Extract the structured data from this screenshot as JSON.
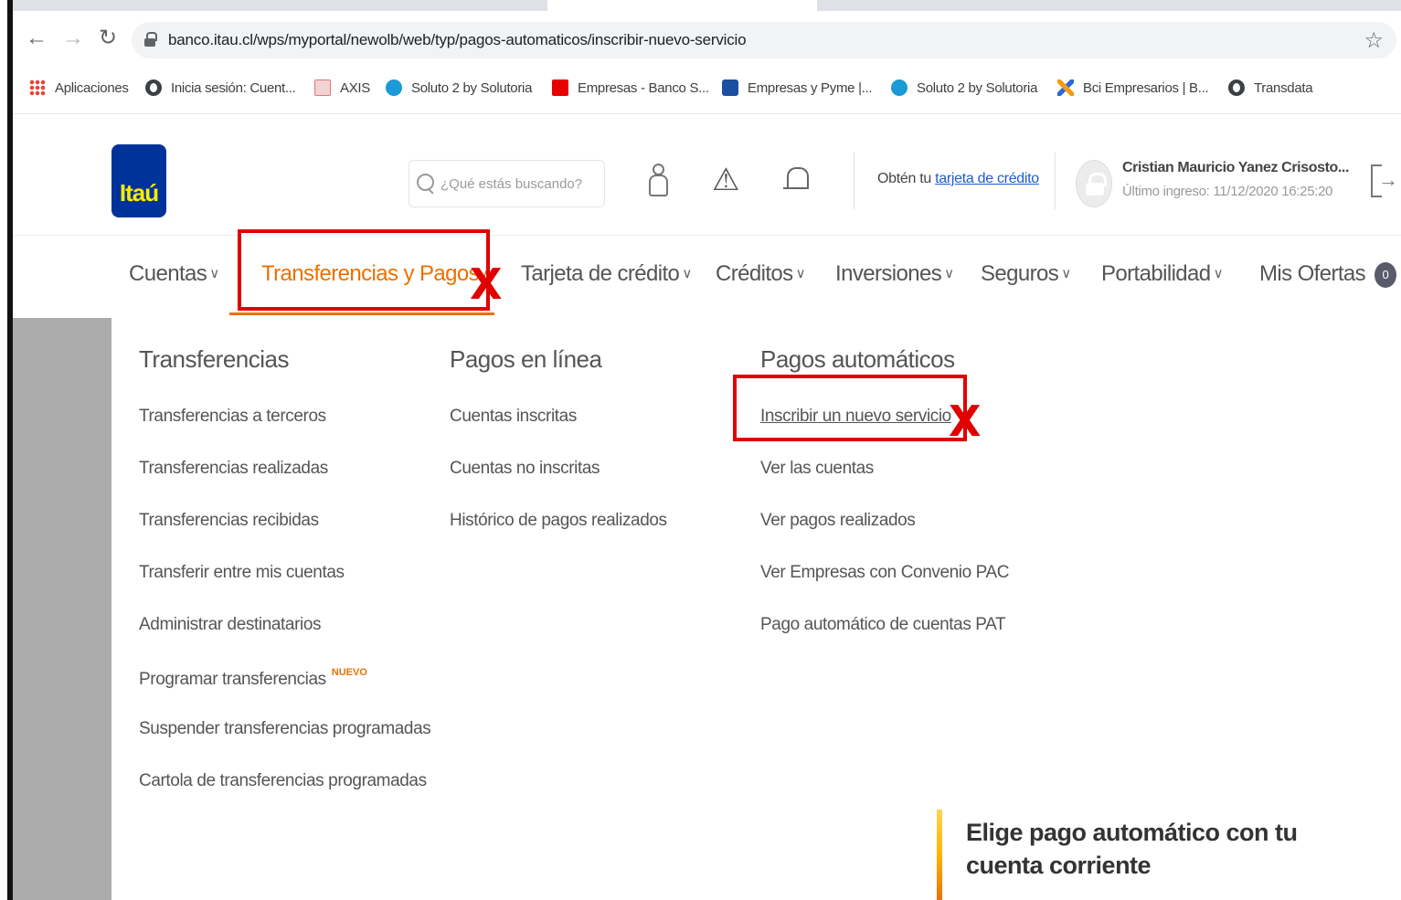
{
  "browser": {
    "url": "banco.itau.cl/wps/myportal/newolb/web/typ/pagos-automaticos/inscribir-nuevo-servicio",
    "bookmarks": [
      {
        "label": "Aplicaciones",
        "icon": "apps-grid-icon"
      },
      {
        "label": "Inicia sesión: Cuent...",
        "icon": "globe-icon"
      },
      {
        "label": "AXIS",
        "icon": "axis-icon"
      },
      {
        "label": "Soluto 2 by Solutoria",
        "icon": "soluto-icon"
      },
      {
        "label": "Empresas - Banco S...",
        "icon": "santander-icon"
      },
      {
        "label": "Empresas y Pyme |...",
        "icon": "bci-icon"
      },
      {
        "label": "Soluto 2 by Solutoria",
        "icon": "soluto-icon"
      },
      {
        "label": "Bci Empresarios | B...",
        "icon": "bci-empresarios-icon"
      },
      {
        "label": "Transdata",
        "icon": "globe-icon"
      }
    ]
  },
  "header": {
    "logo_text": "Itaú",
    "search_placeholder": "¿Qué estás buscando?",
    "promo_prefix": "Obtén tu ",
    "promo_link": "tarjeta de crédito",
    "user_name": "Cristian Mauricio Yanez Crisosto...",
    "last_login": "Último ingreso: 11/12/2020 16:25:20"
  },
  "nav": {
    "items": [
      {
        "label": "Cuentas",
        "chevron": "∨"
      },
      {
        "label": "Transferencias y Pagos",
        "chevron": "∧"
      },
      {
        "label": "Tarjeta de crédito",
        "chevron": "∨"
      },
      {
        "label": "Créditos",
        "chevron": "∨"
      },
      {
        "label": "Inversiones",
        "chevron": "∨"
      },
      {
        "label": "Seguros",
        "chevron": "∨"
      },
      {
        "label": "Portabilidad",
        "chevron": "∨"
      },
      {
        "label": "Mis Ofertas",
        "badge": "0"
      }
    ]
  },
  "menu": {
    "transferencias": {
      "title": "Transferencias",
      "links": [
        "Transferencias a terceros",
        "Transferencias realizadas",
        "Transferencias recibidas",
        "Transferir entre mis cuentas",
        "Administrar destinatarios",
        "Programar transferencias",
        "Suspender transferencias programadas",
        "Cartola de transferencias programadas"
      ],
      "new_badge": "NUEVO"
    },
    "pagos_linea": {
      "title": "Pagos en línea",
      "links": [
        "Cuentas inscritas",
        "Cuentas no inscritas",
        "Histórico de pagos realizados"
      ]
    },
    "pagos_automaticos": {
      "title": "Pagos automáticos",
      "links": [
        "Inscribir un nuevo servicio",
        "Ver las cuentas",
        "Ver pagos realizados",
        "Ver Empresas con Convenio PAC",
        "Pago automático de cuentas PAT"
      ]
    }
  },
  "promo_banner": {
    "title": "Elige pago automático con tu cuenta corriente"
  },
  "annotations": {
    "mark": "X",
    "color": "#e00000"
  },
  "colors": {
    "brand_blue": "#003399",
    "brand_yellow": "#ffec00",
    "accent_orange": "#ec7000"
  }
}
